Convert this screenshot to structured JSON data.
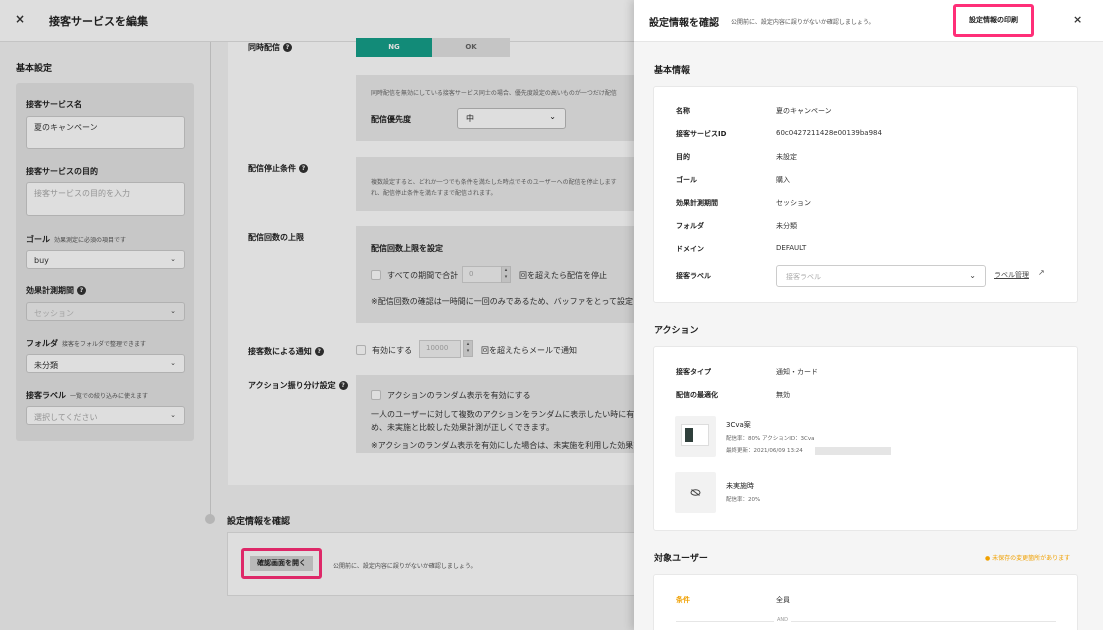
{
  "editor": {
    "close_glyph": "×",
    "title": "接客サービスを編集",
    "basic_title": "基本設定",
    "name_label": "接客サービス名",
    "name_value": "夏のキャンペーン",
    "purpose_label": "接客サービスの目的",
    "purpose_placeholder": "接客サービスの目的を入力",
    "goal_label": "ゴール",
    "goal_note": "効果測定に必須の項目です",
    "goal_value": "buy",
    "period_label": "効果計測期間",
    "period_value": "セッション",
    "folder_label": "フォルダ",
    "folder_note": "接客をフォルダで整理できます",
    "folder_value": "未分類",
    "label_label": "接客ラベル",
    "label_note": "一覧での絞り込みに使えます",
    "label_placeholder": "選択してください",
    "concurrent_label": "同時配信",
    "ng": "NG",
    "ok": "OK",
    "concurrent_note": "同時配信を無効にしている接客サービス同士の場合、優先度設定の高いものが一つだけ配信",
    "priority_label": "配信優先度",
    "priority_value": "中",
    "stop_label": "配信停止条件",
    "stop_note1": "複数設定すると、どれか一つでも条件を満たした時点でそのユーザーへの配信を停止します",
    "stop_note2": "れ、配信停止条件を満たすまで配信されます。",
    "limit_label": "配信回数の上限",
    "limit_set": "配信回数上限を設定",
    "limit_all_prefix": "すべての期間で合計",
    "limit_all_value": "0",
    "limit_all_suffix": "回を超えたら配信を停止",
    "limit_note": "※配信回数の確認は一時間に一回のみであるため、バッファをとって設定し",
    "notify_label": "接客数による通知",
    "notify_enable": "有効にする",
    "notify_value": "10000",
    "notify_suffix": "回を超えたらメールで通知",
    "random_label": "アクション振り分け設定",
    "random_check": "アクションのランダム表示を有効にする",
    "random_note1": "一人のユーザーに対して複数のアクションをランダムに表示したい時に有効",
    "random_note2": "め、未実施と比較した効果計測が正しくできます。",
    "random_note3": "※アクションのランダム表示を有効にした場合は、未実施を利用した効果計",
    "confirm_title": "設定情報を確認",
    "open_button": "確認画面を開く",
    "open_note": "公開前に、設定内容に誤りがないか確認しましょう。"
  },
  "panel": {
    "title": "設定情報を確認",
    "subtitle": "公開前に、設定内容に誤りがないか確認しましょう。",
    "print_button": "設定情報の印刷",
    "close_glyph": "×",
    "basic_title": "基本情報",
    "rows": [
      {
        "k": "名称",
        "v": "夏のキャンペーン"
      },
      {
        "k": "接客サービスID",
        "v": "60c0427211428e00139ba984"
      },
      {
        "k": "目的",
        "v": "未設定"
      },
      {
        "k": "ゴール",
        "v": "購入"
      },
      {
        "k": "効果計測期間",
        "v": "セッション"
      },
      {
        "k": "フォルダ",
        "v": "未分類"
      },
      {
        "k": "ドメイン",
        "v": "DEFAULT"
      }
    ],
    "label_key": "接客ラベル",
    "label_placeholder": "接客ラベル",
    "label_mgmt": "ラベル管理",
    "action_title": "アクション",
    "type_key": "接客タイプ",
    "type_value": "通知・カード",
    "opt_key": "配信の最適化",
    "opt_value": "無効",
    "action1_name": "3Cva案",
    "action1_meta1": "配信率：80%  アクションID：3Cva",
    "action1_meta2": "最終更新：2021/06/09 13:24",
    "action2_name": "未実施時",
    "action2_meta": "配信率：20%",
    "target_title": "対象ユーザー",
    "unsaved": "● 未保存の変更箇所があります",
    "cond_key": "条件",
    "cond_value": "全員",
    "and": "AND"
  }
}
